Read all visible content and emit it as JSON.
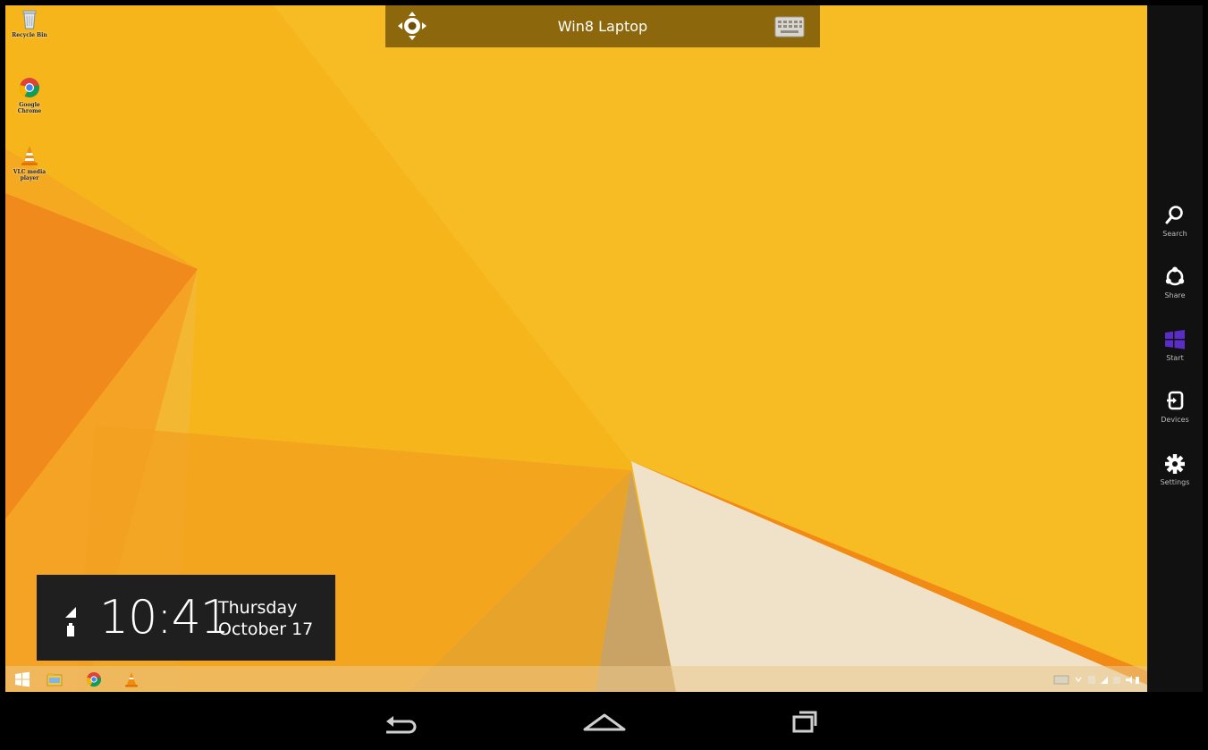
{
  "window": {
    "title": "Win8 Laptop"
  },
  "desktop_icons": [
    {
      "label": "Recycle Bin",
      "icon": "recycle-bin-icon"
    },
    {
      "label": "Google Chrome",
      "icon": "chrome-icon"
    },
    {
      "label": "VLC media player",
      "icon": "vlc-icon"
    }
  ],
  "charms": [
    {
      "label": "Search",
      "icon": "search-icon"
    },
    {
      "label": "Share",
      "icon": "share-icon"
    },
    {
      "label": "Start",
      "icon": "windows-logo-icon"
    },
    {
      "label": "Devices",
      "icon": "devices-icon"
    },
    {
      "label": "Settings",
      "icon": "gear-icon"
    }
  ],
  "clock": {
    "time": "10:41",
    "day": "Thursday",
    "date": "October 17"
  },
  "taskbar": {
    "items": [
      "start-icon",
      "file-explorer-icon",
      "chrome-icon",
      "vlc-icon"
    ]
  },
  "navbar": {
    "items": [
      "back-icon",
      "home-icon",
      "recent-apps-icon"
    ]
  },
  "colors": {
    "wallpaper": "#f5b51a",
    "charms_bg": "#111111",
    "start_purple": "#5a2dc6"
  }
}
